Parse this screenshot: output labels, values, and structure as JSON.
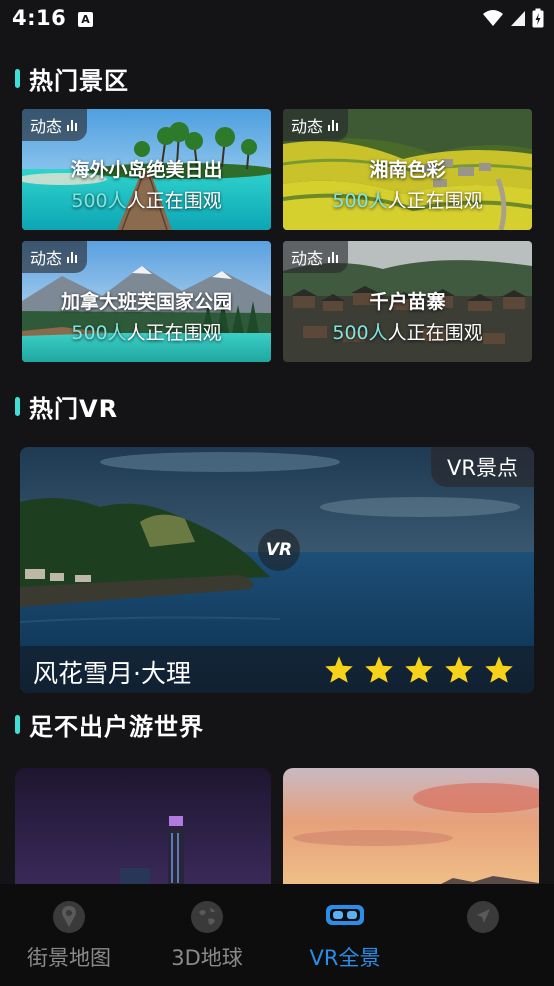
{
  "status_bar": {
    "time": "4:16",
    "notif_letter": "A"
  },
  "sections": {
    "hot_scenic": "热门景区",
    "hot_vr": "热门VR",
    "world": "足不出户游世界"
  },
  "scenic_cards": [
    {
      "tag": "动态",
      "name": "海外小岛绝美日出",
      "viewers_num": "500人",
      "viewers_rest": "人正在围观"
    },
    {
      "tag": "动态",
      "name": "湘南色彩",
      "viewers_num": "500人",
      "viewers_rest": "人正在围观"
    },
    {
      "tag": "动态",
      "name": "加拿大班芙国家公园",
      "viewers_num": "500人",
      "viewers_rest": "人正在围观"
    },
    {
      "tag": "动态",
      "name": "千户苗寨",
      "viewers_num": "500人",
      "viewers_rest": "人正在围观"
    }
  ],
  "vr_card": {
    "badge": "VR景点",
    "logo": "VR",
    "title": "风花雪月·大理",
    "rating": 5,
    "rating_max": 5
  },
  "bottom_nav": [
    {
      "label": "街景地图",
      "icon": "location-pin-icon",
      "active": false
    },
    {
      "label": "3D地球",
      "icon": "globe-icon",
      "active": false
    },
    {
      "label": "VR全景",
      "icon": "vr-headset-icon",
      "active": true
    },
    {
      "label": "",
      "icon": "navigation-arrow-icon",
      "active": false
    }
  ],
  "colors": {
    "accent": "#3ee0d5",
    "active_nav": "#2a8ee8",
    "star": "#f7d21a",
    "background": "#141417"
  }
}
